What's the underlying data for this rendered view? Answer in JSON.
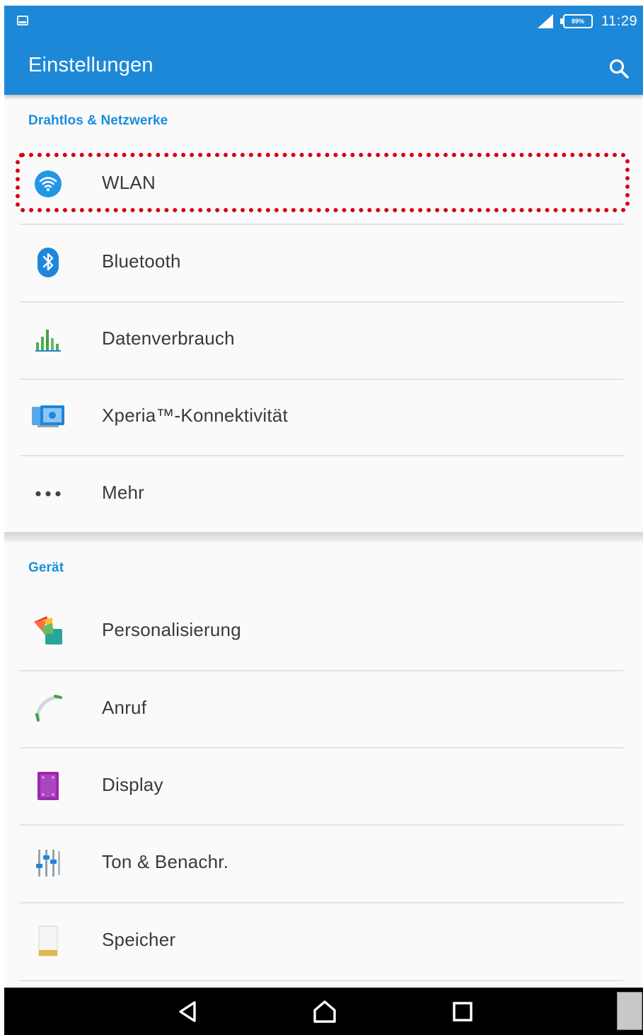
{
  "status_bar": {
    "battery_label": "89%",
    "time": "11:29"
  },
  "app_bar": {
    "title": "Einstellungen"
  },
  "sections": [
    {
      "header": "Drahtlos & Netzwerke",
      "items": [
        {
          "label": "WLAN",
          "icon": "wifi-icon",
          "highlighted": true
        },
        {
          "label": "Bluetooth",
          "icon": "bluetooth-icon"
        },
        {
          "label": "Datenverbrauch",
          "icon": "data-usage-icon"
        },
        {
          "label": "Xperia™-Konnektivität",
          "icon": "xperia-connectivity-icon"
        },
        {
          "label": "Mehr",
          "icon": "more-dots-icon"
        }
      ]
    },
    {
      "header": "Gerät",
      "items": [
        {
          "label": "Personalisierung",
          "icon": "personalization-icon"
        },
        {
          "label": "Anruf",
          "icon": "phone-icon"
        },
        {
          "label": "Display",
          "icon": "display-icon"
        },
        {
          "label": "Ton & Benachr.",
          "icon": "sound-equalizer-icon"
        },
        {
          "label": "Speicher",
          "icon": "storage-icon"
        }
      ]
    }
  ],
  "colors": {
    "primary": "#1e88d8",
    "section_header": "#1a8de0",
    "highlight_border": "#d60010",
    "nav_bar": "#000000"
  }
}
